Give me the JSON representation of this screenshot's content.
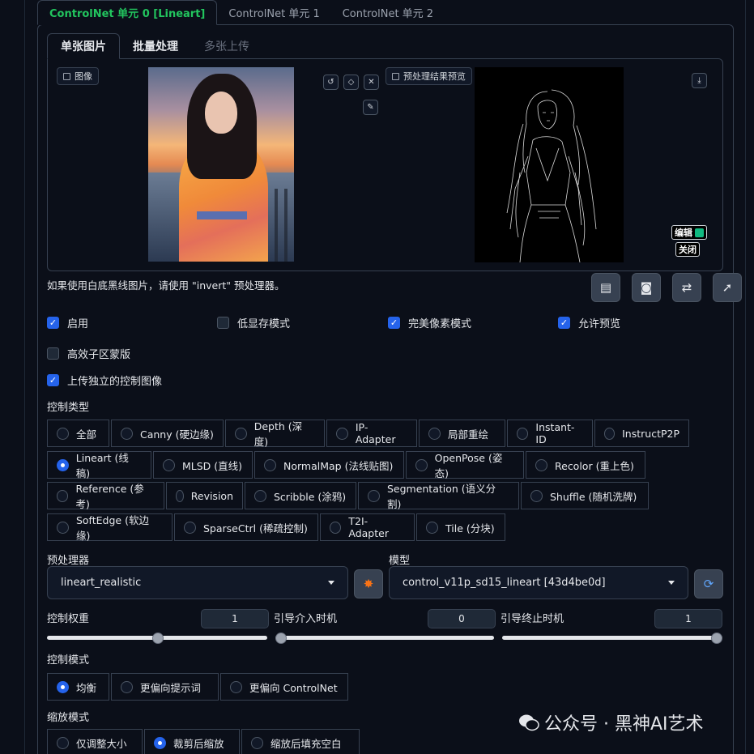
{
  "top_tabs": [
    {
      "label": "ControlNet 单元 0 [Lineart]",
      "active": true
    },
    {
      "label": "ControlNet 单元 1",
      "active": false
    },
    {
      "label": "ControlNet 单元 2",
      "active": false
    }
  ],
  "inner_tabs": [
    {
      "label": "单张图片",
      "active": true
    },
    {
      "label": "批量处理",
      "active": false
    },
    {
      "label": "多张上传",
      "active": false
    }
  ],
  "image_panel": {
    "input_label": "图像",
    "preview_label": "预处理结果预览",
    "edit_tag": "编辑",
    "close_tag": "关闭"
  },
  "hint_text": "如果使用白底黑线图片，请使用 \"invert\" 预处理器。",
  "checkboxes": [
    {
      "label": "启用",
      "checked": true
    },
    {
      "label": "低显存模式",
      "checked": false
    },
    {
      "label": "完美像素模式",
      "checked": true
    },
    {
      "label": "允许预览",
      "checked": true
    },
    {
      "label": "高效子区蒙版",
      "checked": false
    },
    {
      "label": "上传独立的控制图像",
      "checked": true
    }
  ],
  "control_type": {
    "label": "控制类型",
    "rows": [
      [
        "全部",
        "Canny (硬边缘)",
        "Depth (深度)",
        "IP-Adapter",
        "局部重绘",
        "Instant-ID",
        "InstructP2P"
      ],
      [
        "Lineart (线稿)",
        "MLSD (直线)",
        "NormalMap (法线贴图)",
        "OpenPose (姿态)",
        "Recolor (重上色)"
      ],
      [
        "Reference (参考)",
        "Revision",
        "Scribble (涂鸦)",
        "Segmentation (语义分割)",
        "Shuffle (随机洗牌)"
      ],
      [
        "SoftEdge (软边缘)",
        "SparseCtrl (稀疏控制)",
        "T2I-Adapter",
        "Tile (分块)"
      ]
    ],
    "selected": "Lineart (线稿)"
  },
  "preprocessor": {
    "label": "预处理器",
    "value": "lineart_realistic"
  },
  "model": {
    "label": "模型",
    "value": "control_v11p_sd15_lineart [43d4be0d]"
  },
  "sliders": [
    {
      "label": "控制权重",
      "value": "1",
      "fraction": 0.5
    },
    {
      "label": "引导介入时机",
      "value": "0",
      "fraction": 0.0
    },
    {
      "label": "引导终止时机",
      "value": "1",
      "fraction": 1.0
    }
  ],
  "control_mode": {
    "label": "控制模式",
    "options": [
      "均衡",
      "更偏向提示词",
      "更偏向 ControlNet"
    ],
    "selected": "均衡"
  },
  "resize_mode": {
    "label": "缩放模式",
    "options": [
      "仅调整大小",
      "裁剪后缩放",
      "缩放后填充空白"
    ],
    "selected": "裁剪后缩放"
  },
  "watermark": {
    "text": "公众号 · 黑神AI艺术"
  },
  "colors": {
    "accent_green": "#22c55e",
    "accent_blue": "#2563eb",
    "background": "#0b0f19"
  }
}
